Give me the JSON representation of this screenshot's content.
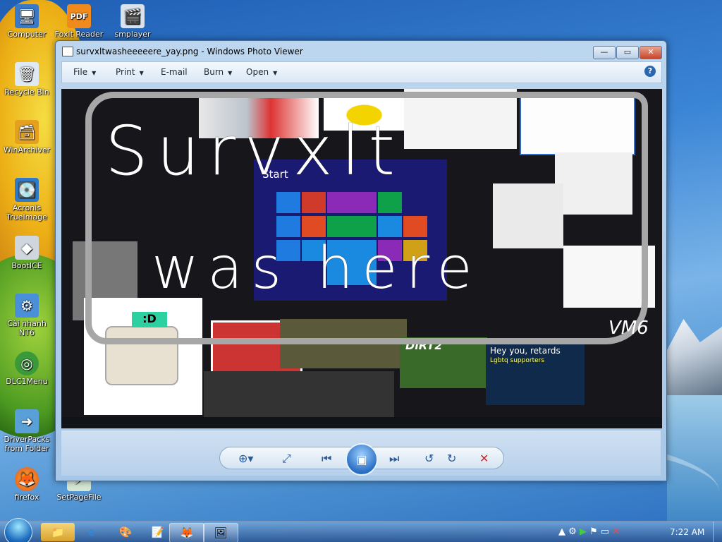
{
  "desktop_icons": [
    {
      "label": "Computer",
      "icon": "computer-icon"
    },
    {
      "label": "Foxit Reader",
      "icon": "pdf-icon"
    },
    {
      "label": "smplayer",
      "icon": "smplayer-icon"
    },
    {
      "label": "Recycle Bin",
      "icon": "recycle-bin-icon"
    },
    {
      "label": "WinArchiver",
      "icon": "archive-icon"
    },
    {
      "label": "Acronis TrueImage",
      "icon": "acronis-icon"
    },
    {
      "label": "BootICE",
      "icon": "bootice-icon"
    },
    {
      "label": "Cài nhanh NT6",
      "icon": "install-icon"
    },
    {
      "label": "DLC1Menu",
      "icon": "dlc-icon"
    },
    {
      "label": "DriverPacks from Folder",
      "icon": "driverpack-icon"
    },
    {
      "label": "firefox",
      "icon": "firefox-icon"
    },
    {
      "label": "SetPageFile",
      "icon": "setpagefile-icon"
    }
  ],
  "window": {
    "title": "survxltwasheeeeere_yay.png - Windows Photo Viewer",
    "minimize": "—",
    "maximize": "▭",
    "close": "✕"
  },
  "menubar": {
    "items": [
      "File",
      "Print",
      "E-mail",
      "Burn",
      "Open"
    ],
    "help": "?"
  },
  "image_content": {
    "scrawl_line1": "Survxlt",
    "scrawl_line2": "was here",
    "signature": "VM6",
    "start_label": "Start",
    "meme_text": "Hey you, retards",
    "meme_sub": "Lgbtq supporters",
    "dirt_title": "DiRT2"
  },
  "controls": {
    "zoom": "⊕▾",
    "fit": "⤢",
    "previous": "⏮",
    "slideshow": "▣",
    "next": "⏭",
    "rotate_left": "↺",
    "rotate_right": "↻",
    "delete": "✕"
  },
  "taskbar": {
    "items": [
      {
        "name": "explorer",
        "icon": "folder-icon"
      },
      {
        "name": "internet-explorer",
        "icon": "ie-icon"
      },
      {
        "name": "paint",
        "icon": "paint-icon"
      },
      {
        "name": "notepad",
        "icon": "notepad-icon"
      },
      {
        "name": "firefox",
        "icon": "firefox-icon"
      },
      {
        "name": "photo-viewer",
        "icon": "photo-viewer-icon"
      }
    ],
    "clock": "7:22 AM"
  },
  "colors": {
    "accent": "#2a6fc4",
    "close_red": "#c8452a",
    "start_tiles": [
      "#e04b24",
      "#1f7be0",
      "#0fa04a",
      "#8a2ab7",
      "#d0a018"
    ]
  }
}
